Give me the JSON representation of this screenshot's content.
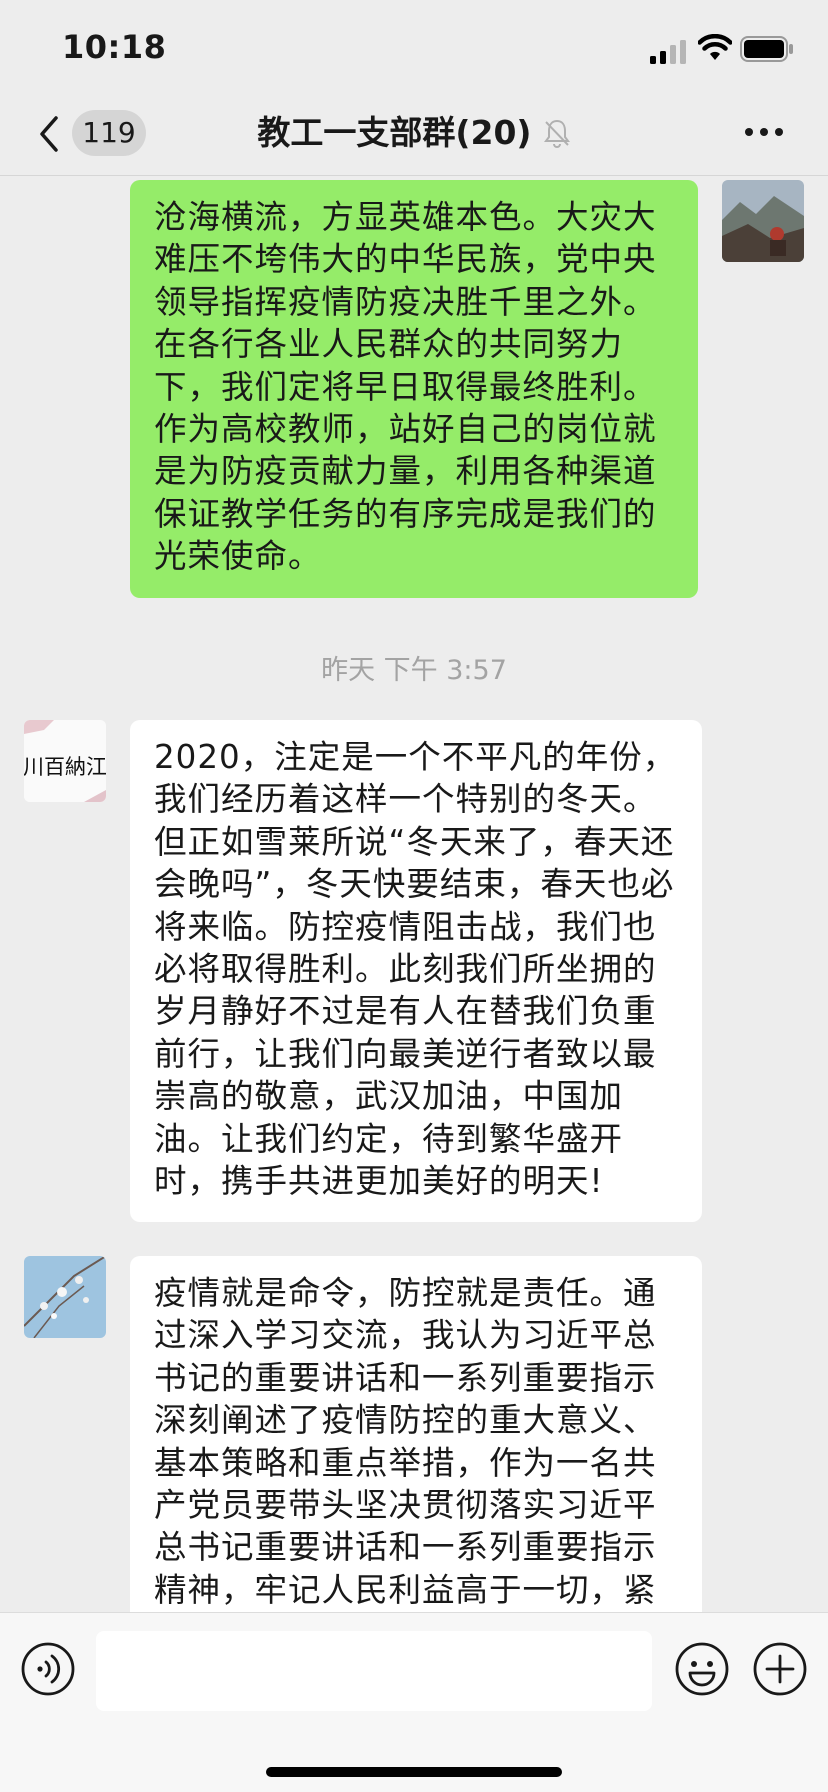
{
  "status_bar": {
    "time": "10:18",
    "icons": [
      "signal-icon",
      "wifi-icon",
      "battery-icon"
    ]
  },
  "nav": {
    "back_icon": "chevron-left-icon",
    "unread_count": "119",
    "title": "教工一支部群(20)",
    "mute_icon": "bell-muted-icon",
    "more_icon": "more-dots-icon"
  },
  "colors": {
    "background": "#ededed",
    "outgoing_bubble": "#95ec69",
    "incoming_bubble": "#ffffff",
    "timestamp": "#a3a3a3"
  },
  "messages": [
    {
      "direction": "outgoing",
      "avatar": "mountain-photo-avatar",
      "text": "沧海横流，方显英雄本色。大灾大难压不垮伟大的中华民族，党中央领导指挥疫情防疫决胜千里之外。在各行各业人民群众的共同努力下，我们定将早日取得最终胜利。作为高校教师，站好自己的岗位就是为防疫贡献力量，利用各种渠道保证教学任务的有序完成是我们的光荣使命。"
    },
    {
      "direction": "timestamp",
      "text": "昨天 下午 3:57"
    },
    {
      "direction": "incoming",
      "avatar": "calligraphy-avatar",
      "avatar_text": "川百納江",
      "text": "2020，注定是一个不平凡的年份，我们经历着这样一个特别的冬天。但正如雪莱所说“冬天来了，春天还会晚吗”，冬天快要结束，春天也必将来临。防控疫情阻击战，我们也必将取得胜利。此刻我们所坐拥的岁月静好不过是有人在替我们负重前行，让我们向最美逆行者致以最崇高的敬意，武汉加油，中国加油。让我们约定，待到繁华盛开时，携手共进更加美好的明天!"
    },
    {
      "direction": "incoming",
      "avatar": "blossom-sky-avatar",
      "text": "疫情就是命令，防控就是责任。通过深入学习交流，我认为习近平总书记的重要讲话和一系列重要指示深刻阐述了疫情防控的重大意义、基本策略和重点举措，作为一名共产党员要带头坚决贯彻落实习近平总书记重要讲话和一系列重要指示精神，牢记人民利益高于一切，紧"
    }
  ],
  "input_bar": {
    "voice_icon": "voice-icon",
    "input_value": "",
    "emoji_icon": "emoji-icon",
    "plus_icon": "plus-icon"
  }
}
